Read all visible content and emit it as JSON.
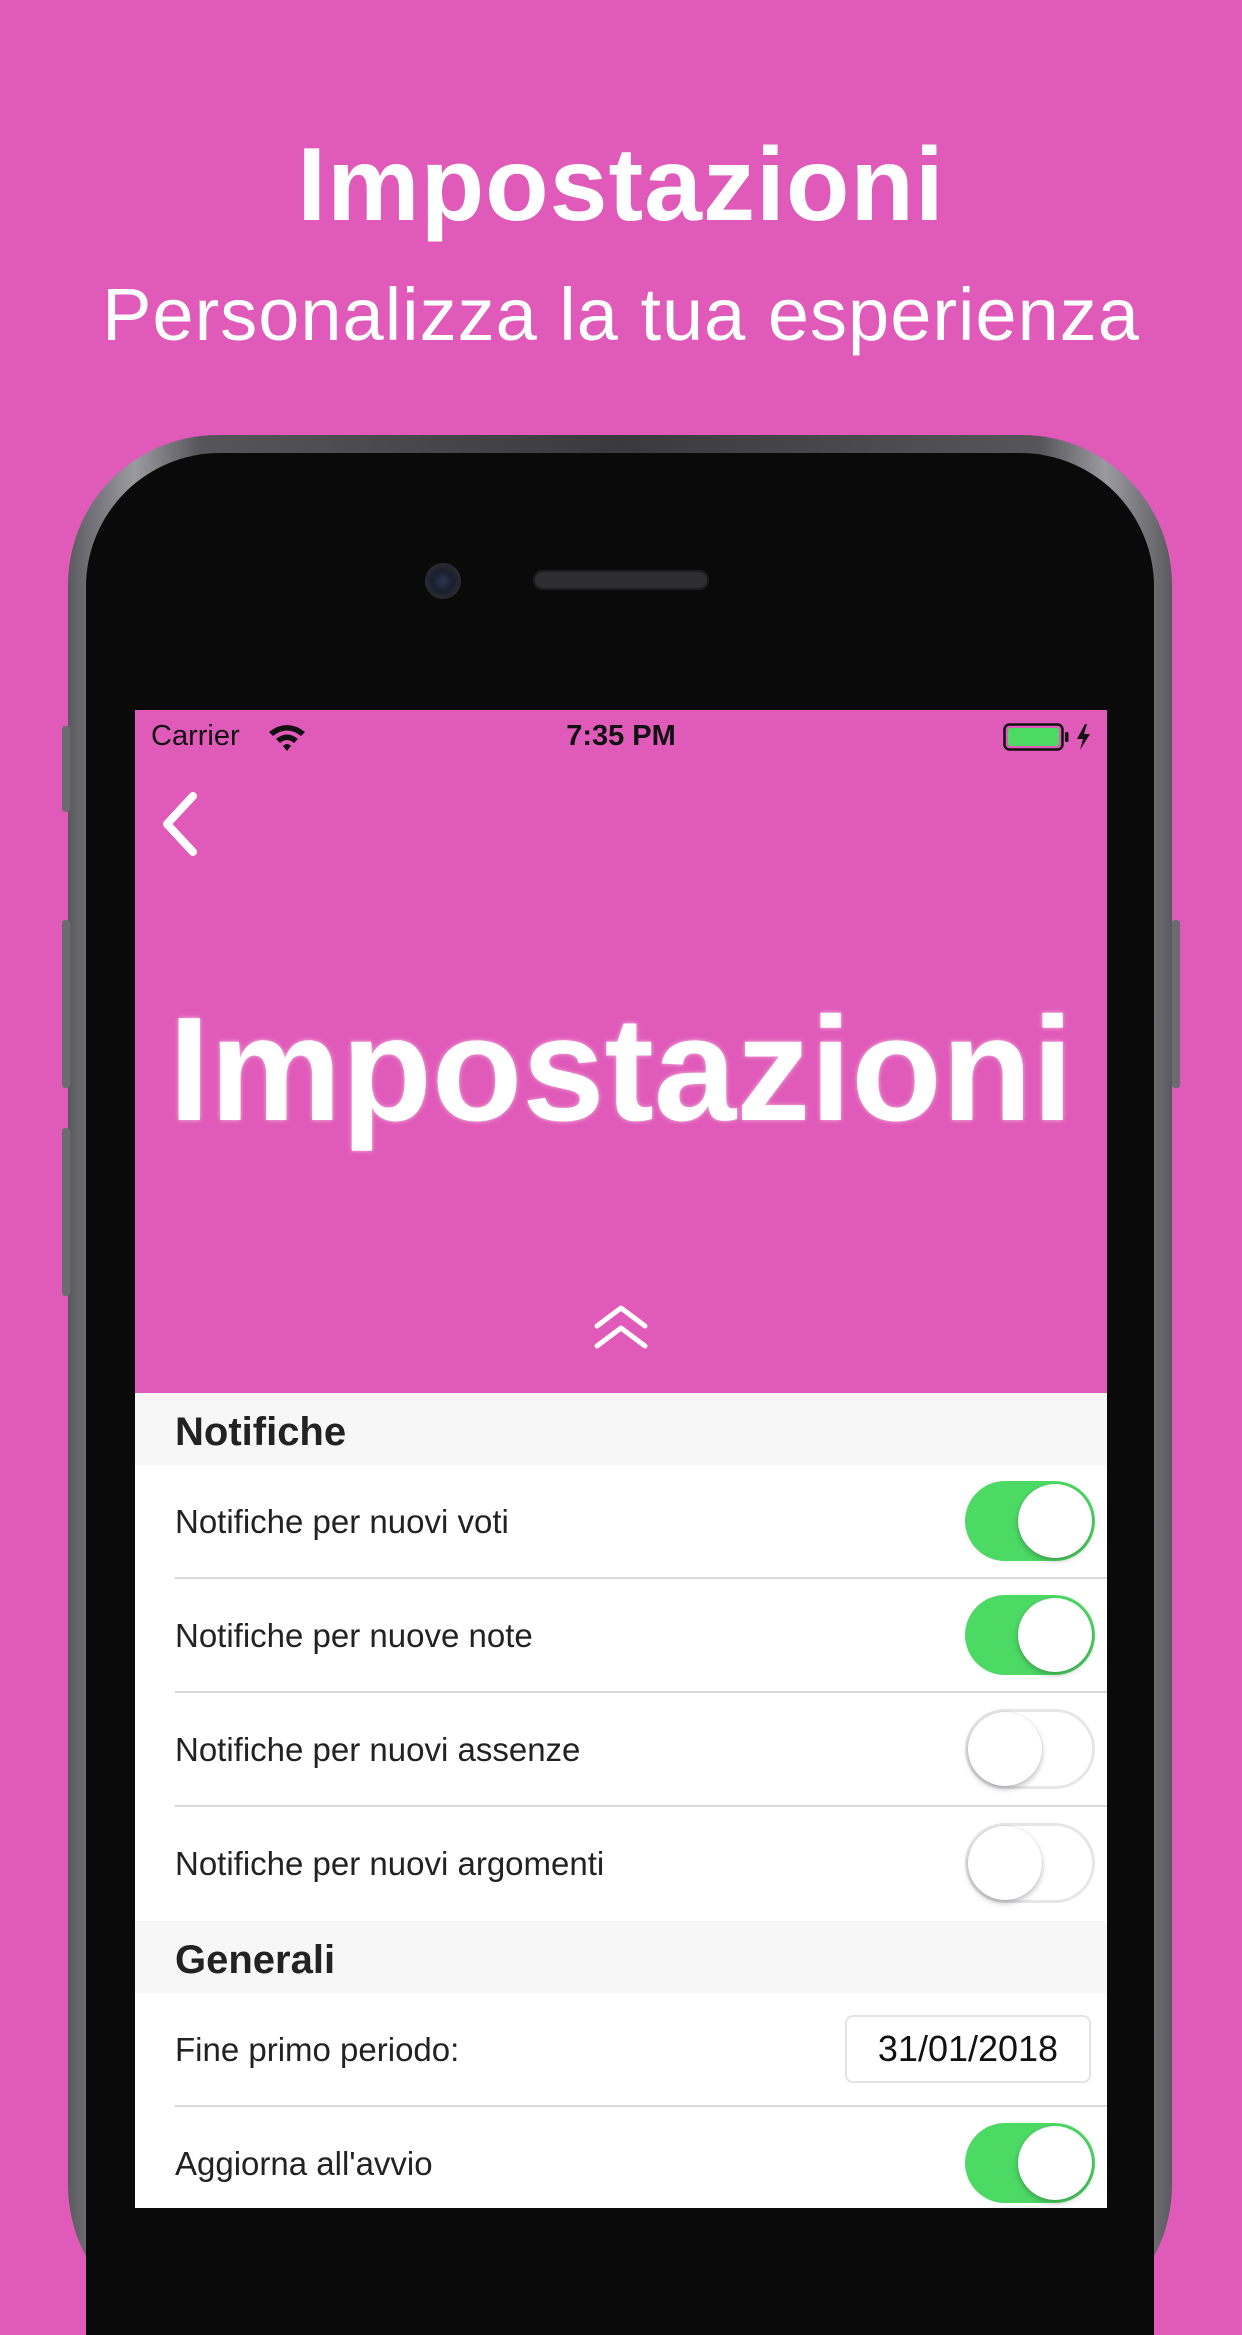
{
  "promo": {
    "title": "Impostazioni",
    "subtitle": "Personalizza la tua esperienza"
  },
  "status_bar": {
    "carrier": "Carrier",
    "time": "7:35 PM"
  },
  "header": {
    "title": "Impostazioni"
  },
  "sections": {
    "notifiche": {
      "title": "Notifiche",
      "rows": [
        {
          "label": "Notifiche per nuovi voti",
          "on": true
        },
        {
          "label": "Notifiche per nuove note",
          "on": true
        },
        {
          "label": "Notifiche per nuovi assenze",
          "on": false
        },
        {
          "label": "Notifiche per nuovi argomenti",
          "on": false
        }
      ]
    },
    "generali": {
      "title": "Generali",
      "end_period_label": "Fine primo periodo:",
      "end_period_value": "31/01/2018",
      "refresh_label": "Aggiorna all'avvio",
      "refresh_on": true
    }
  },
  "colors": {
    "accent": "#E05BB9",
    "switch_on": "#4CD964",
    "battery": "#4CD964"
  }
}
